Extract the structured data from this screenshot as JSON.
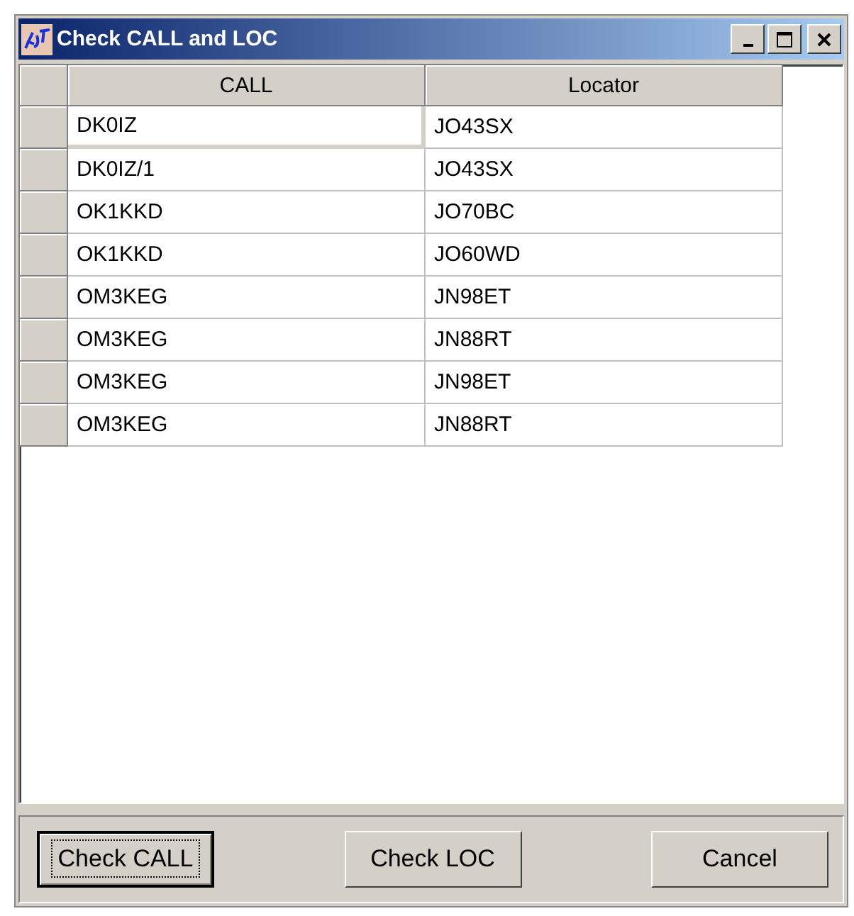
{
  "window": {
    "title": "Check CALL and LOC"
  },
  "table": {
    "columns": [
      "CALL",
      "Locator"
    ],
    "rows": [
      {
        "call": "DK0IZ",
        "locator": "JO43SX",
        "selected": true
      },
      {
        "call": "DK0IZ/1",
        "locator": "JO43SX",
        "selected": false
      },
      {
        "call": "OK1KKD",
        "locator": "JO70BC",
        "selected": false
      },
      {
        "call": "OK1KKD",
        "locator": "JO60WD",
        "selected": false
      },
      {
        "call": "OM3KEG",
        "locator": "JN98ET",
        "selected": false
      },
      {
        "call": "OM3KEG",
        "locator": "JN88RT",
        "selected": false
      },
      {
        "call": "OM3KEG",
        "locator": "JN98ET",
        "selected": false
      },
      {
        "call": "OM3KEG",
        "locator": "JN88RT",
        "selected": false
      }
    ]
  },
  "buttons": [
    {
      "label": "Check CALL",
      "default": true
    },
    {
      "label": "Check LOC",
      "default": false
    },
    {
      "label": "Cancel",
      "default": false
    }
  ]
}
